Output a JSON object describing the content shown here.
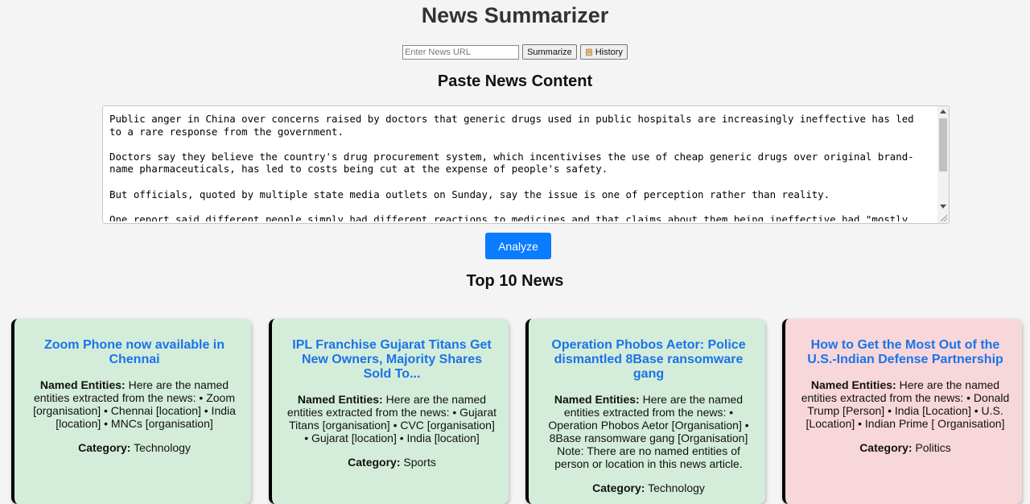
{
  "app": {
    "title": "News Summarizer"
  },
  "url_bar": {
    "placeholder": "Enter News URL",
    "summarize_label": "Summarize",
    "history_label": "History",
    "history_icon": "scroll-icon"
  },
  "paste_section": {
    "heading": "Paste News Content",
    "content": "Public anger in China over concerns raised by doctors that generic drugs used in public hospitals are increasingly ineffective has led to a rare response from the government.\n\nDoctors say they believe the country's drug procurement system, which incentivises the use of cheap generic drugs over original brand-name pharmaceuticals, has led to costs being cut at the expense of people's safety.\n\nBut officials, quoted by multiple state media outlets on Sunday, say the issue is one of perception rather than reality.\n\nOne report said different people simply had different reactions to medicines and that claims about them being ineffective had \"mostly",
    "analyze_label": "Analyze"
  },
  "top_news": {
    "heading": "Top 10 News",
    "entities_label": "Named Entities:",
    "category_label": "Category:",
    "colors": {
      "green": "#d4edda",
      "pink": "#f8d7da",
      "link": "#1a73e8"
    },
    "cards": [
      {
        "title": "Zoom Phone now available in Chennai",
        "entities": "Here are the named entities extracted from the news: • Zoom [organisation] • Chennai [location] • India [location] • MNCs [organisation]",
        "category": "Technology"
      },
      {
        "title": "IPL Franchise Gujarat Titans Get New Owners, Majority Shares Sold To...",
        "entities": "Here are the named entities extracted from the news: • Gujarat Titans [organisation] • CVC [organisation] • Gujarat [location] • India [location]",
        "category": "Sports"
      },
      {
        "title": "Operation Phobos Aetor: Police dismantled 8Base ransomware gang",
        "entities": "Here are the named entities extracted from the news: • Operation Phobos Aetor [Organisation] • 8Base ransomware gang [Organisation] Note: There are no named entities of person or location in this news article.",
        "category": "Technology"
      },
      {
        "title": "How to Get the Most Out of the U.S.-Indian Defense Partnership",
        "entities": "Here are the named entities extracted from the news: • Donald Trump [Person] • India [Location] • U.S. [Location] • Indian Prime [ Organisation]",
        "category": "Politics"
      }
    ]
  }
}
